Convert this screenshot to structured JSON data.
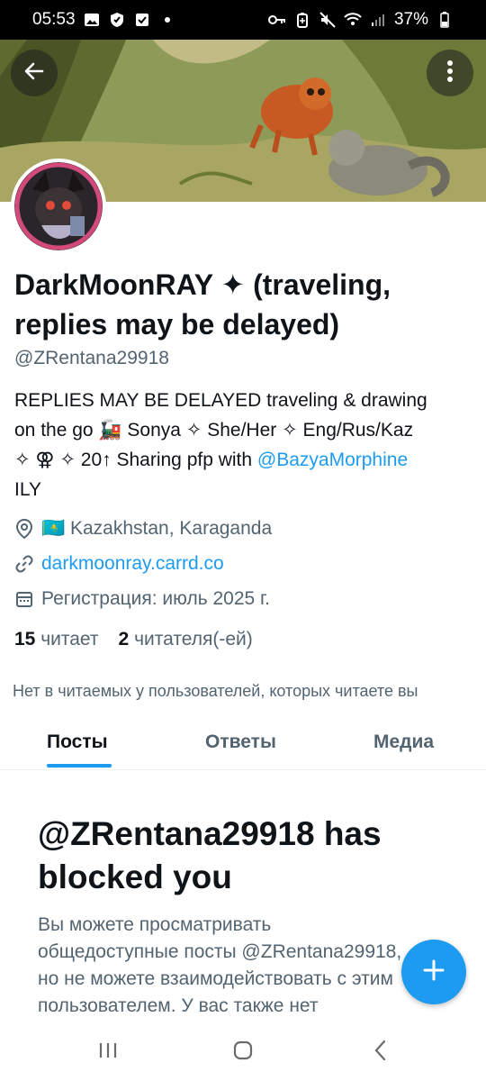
{
  "status_bar": {
    "time": "05:53",
    "battery": "37%",
    "icons_left": [
      "image-icon",
      "shield-icon",
      "check-icon",
      "dot-icon"
    ],
    "icons_right": [
      "key-icon",
      "battery-saver-icon",
      "mute-icon",
      "wifi-icon",
      "signal-icon",
      "battery-icon"
    ]
  },
  "header": {
    "back_icon": "arrow-left-icon",
    "more_icon": "more-vertical-icon"
  },
  "profile": {
    "name": "DarkMoonRAY ✦ (traveling, replies may be delayed)",
    "handle": "@ZRentana29918",
    "bio_lines": [
      "REPLIES MAY BE DELAYED traveling & drawing",
      "on the go 🚂  Sonya ✧ She/Her ✧ Eng/Rus/Kaz",
      "✧ ⚢ ✧ 20↑ Sharing pfp with "
    ],
    "bio_link": "@BazyaMorphine",
    "bio_tail": "ILY",
    "location": "🇰🇿 Kazakhstan, Karaganda",
    "website": "darkmoonray.carrd.co",
    "joined": "Регистрация: июль 2025 г.",
    "following_count": "15",
    "following_label": "читает",
    "followers_count": "2",
    "followers_label": "читателя(-ей)",
    "followers_note": "Нет в читаемых у пользователей, которых читаете вы"
  },
  "tabs": [
    {
      "label": "Посты",
      "active": true
    },
    {
      "label": "Ответы",
      "active": false
    },
    {
      "label": "Медиа",
      "active": false
    }
  ],
  "blocked": {
    "title": "@ZRentana29918 has blocked you",
    "text": "Вы можете просматривать общедоступные посты @ZRentana29918, но не можете взаимодействовать с этим пользователем. У вас также нет"
  },
  "fab": {
    "icon": "plus-icon"
  },
  "colors": {
    "accent": "#1d9bf0",
    "muted": "#536471",
    "text": "#0f1419"
  }
}
